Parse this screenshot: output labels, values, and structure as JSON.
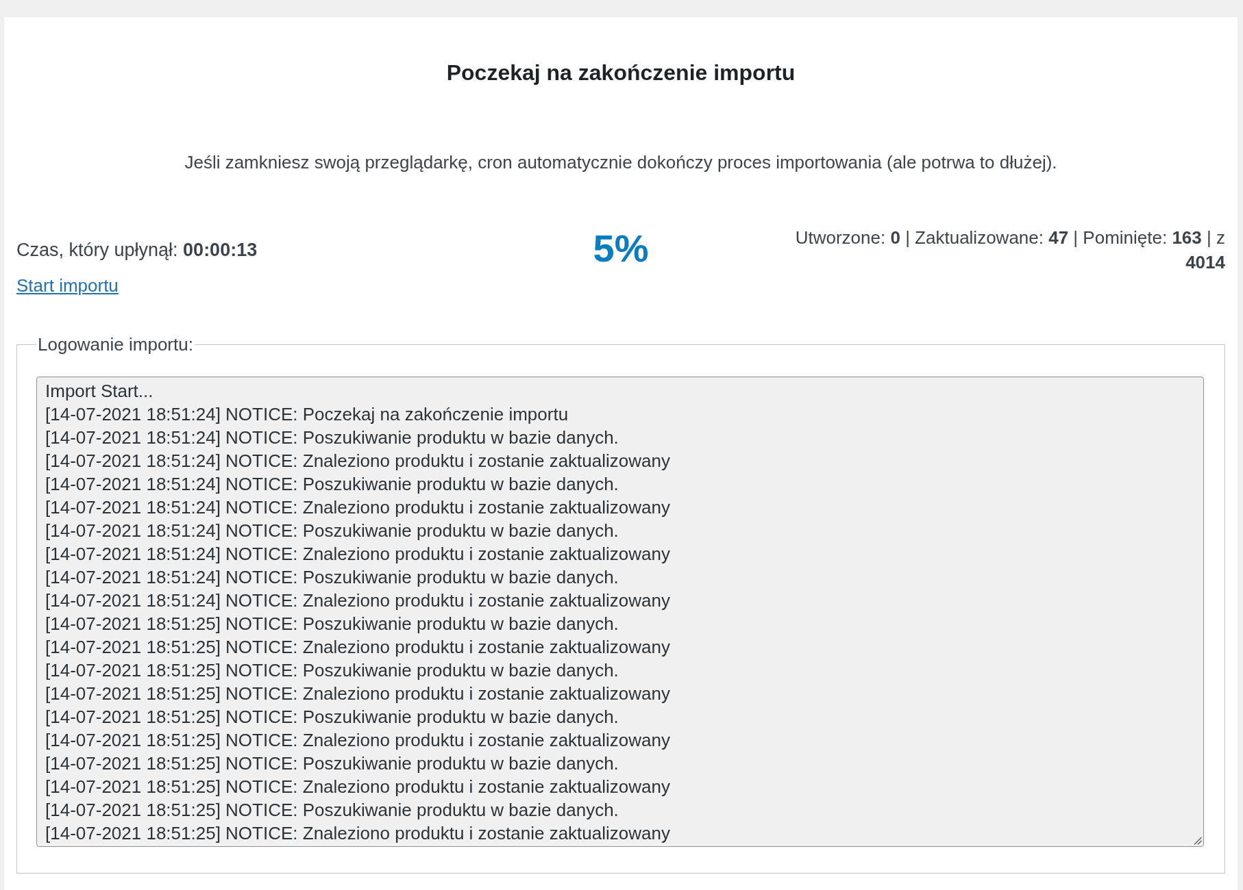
{
  "title": "Poczekaj na zakończenie importu",
  "notice": "Jeśli zamkniesz swoją przeglądarkę, cron automatycznie dokończy proces importowania (ale potrwa to dłużej).",
  "elapsed": "Czas, który upłynął: **00:00:13**",
  "start_link": "Start importu",
  "percent": "5%",
  "counts": "Utworzone: **0** | Zaktualizowane: **47** | Pominięte: **163** | z **4014**",
  "log": {
    "legend": "Logowanie importu:",
    "lines": [
      "Import Start...",
      "[14-07-2021 18:51:24] NOTICE: Poczekaj na zakończenie importu",
      "[14-07-2021 18:51:24] NOTICE: Poszukiwanie produktu w bazie danych.",
      "[14-07-2021 18:51:24] NOTICE: Znaleziono produktu i zostanie zaktualizowany",
      "[14-07-2021 18:51:24] NOTICE: Poszukiwanie produktu w bazie danych.",
      "[14-07-2021 18:51:24] NOTICE: Znaleziono produktu i zostanie zaktualizowany",
      "[14-07-2021 18:51:24] NOTICE: Poszukiwanie produktu w bazie danych.",
      "[14-07-2021 18:51:24] NOTICE: Znaleziono produktu i zostanie zaktualizowany",
      "[14-07-2021 18:51:24] NOTICE: Poszukiwanie produktu w bazie danych.",
      "[14-07-2021 18:51:24] NOTICE: Znaleziono produktu i zostanie zaktualizowany",
      "[14-07-2021 18:51:25] NOTICE: Poszukiwanie produktu w bazie danych.",
      "[14-07-2021 18:51:25] NOTICE: Znaleziono produktu i zostanie zaktualizowany",
      "[14-07-2021 18:51:25] NOTICE: Poszukiwanie produktu w bazie danych.",
      "[14-07-2021 18:51:25] NOTICE: Znaleziono produktu i zostanie zaktualizowany",
      "[14-07-2021 18:51:25] NOTICE: Poszukiwanie produktu w bazie danych.",
      "[14-07-2021 18:51:25] NOTICE: Znaleziono produktu i zostanie zaktualizowany",
      "[14-07-2021 18:51:25] NOTICE: Poszukiwanie produktu w bazie danych.",
      "[14-07-2021 18:51:25] NOTICE: Znaleziono produktu i zostanie zaktualizowany",
      "[14-07-2021 18:51:25] NOTICE: Poszukiwanie produktu w bazie danych.",
      "[14-07-2021 18:51:25] NOTICE: Znaleziono produktu i zostanie zaktualizowany"
    ]
  }
}
